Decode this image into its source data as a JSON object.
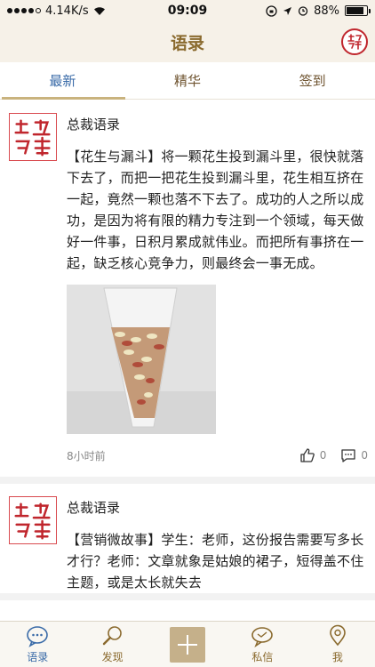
{
  "status_bar": {
    "speed": "4.14K/s",
    "time": "09:09",
    "battery": "88%",
    "battery_level": 0.88
  },
  "header": {
    "title": "语录"
  },
  "tabs": [
    {
      "label": "最新",
      "active": true
    },
    {
      "label": "精华",
      "active": false
    },
    {
      "label": "签到",
      "active": false
    }
  ],
  "posts": [
    {
      "author": "总裁语录",
      "text": "【花生与漏斗】将一颗花生投到漏斗里，很快就落下去了，而把一把花生投到漏斗里，花生相互挤在一起，竟然一颗也落不下去了。成功的人之所以成功，是因为将有限的精力专注到一个领域，每天做好一件事，日积月累成就伟业。而把所有事挤在一起，缺乏核心竞争力，则最终会一事无成。",
      "time": "8小时前",
      "likes": "0",
      "comments": "0"
    },
    {
      "author": "总裁语录",
      "text": "【营销微故事】学生：老师，这份报告需要写多长才行？老师：文章就象是姑娘的裙子，短得盖不住主题，或是太长就失去"
    }
  ],
  "bottom_tabs": [
    {
      "label": "语录",
      "icon": "chat-bubble-icon",
      "active": true
    },
    {
      "label": "发现",
      "icon": "magnifier-icon",
      "active": false
    },
    {
      "label": "",
      "icon": "add-icon",
      "active": false
    },
    {
      "label": "私信",
      "icon": "message-icon",
      "active": false
    },
    {
      "label": "我",
      "icon": "location-pin-icon",
      "active": false
    }
  ],
  "colors": {
    "accent_blue": "#3a6ba8",
    "brand_gold": "#8a6a2e",
    "seal_red": "#c0262d"
  }
}
